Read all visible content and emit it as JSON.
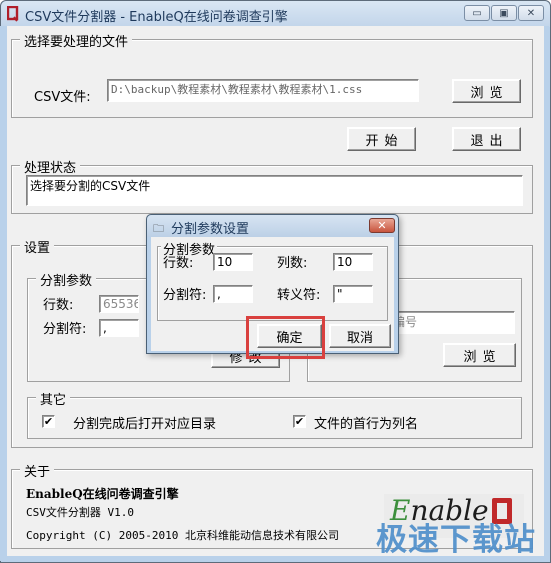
{
  "window": {
    "title": "CSV文件分割器 - EnableQ在线问卷调查引擎",
    "controls": {
      "minimize": "▭",
      "maximize": "▣",
      "close": "✕"
    }
  },
  "file_group": {
    "label": "选择要处理的文件",
    "csv_label": "CSV文件:",
    "csv_path": "D:\\backup\\教程素材\\教程素材\\教程素材\\1.css",
    "browse_button": "浏览"
  },
  "actions": {
    "start_button": "开始",
    "exit_button": "退出"
  },
  "status_group": {
    "label": "处理状态",
    "status_text": "选择要分割的CSV文件"
  },
  "settings_group": {
    "label": "设置",
    "split_params": {
      "label": "分割参数",
      "rows_label": "行数:",
      "rows_value": "65536",
      "delimiter_label": "分割符:",
      "delimiter_value": ",",
      "modify_button": "修改"
    },
    "output": {
      "task_field_value": "每次分割任务编号",
      "browse_button": "浏览"
    },
    "other": {
      "label": "其它",
      "checkboxes": [
        {
          "label": "分割完成后打开对应目录",
          "checked": true,
          "mark": "✔"
        },
        {
          "label": "文件的首行为列名",
          "checked": true,
          "mark": "✔"
        }
      ]
    }
  },
  "about_group": {
    "label": "关于",
    "product": "EnableQ在线问卷调查引擎",
    "app_version": "CSV文件分割器  V1.0",
    "copyright": "Copyright (C) 2005-2010 北京科维能动信息技术有限公司",
    "logo_text_first": "E",
    "logo_text_rest": "nable",
    "watermark": "极速下载站"
  },
  "dialog": {
    "title": "分割参数设置",
    "title_icon": "🗀",
    "close": "✕",
    "group_label": "分割参数",
    "rows_label": "行数:",
    "rows_value": "10",
    "cols_label": "列数:",
    "cols_value": "10",
    "delimiter_label": "分割符:",
    "delimiter_value": ",",
    "escape_label": "转义符:",
    "escape_value": "\"",
    "ok_button": "确定",
    "cancel_button": "取消"
  }
}
